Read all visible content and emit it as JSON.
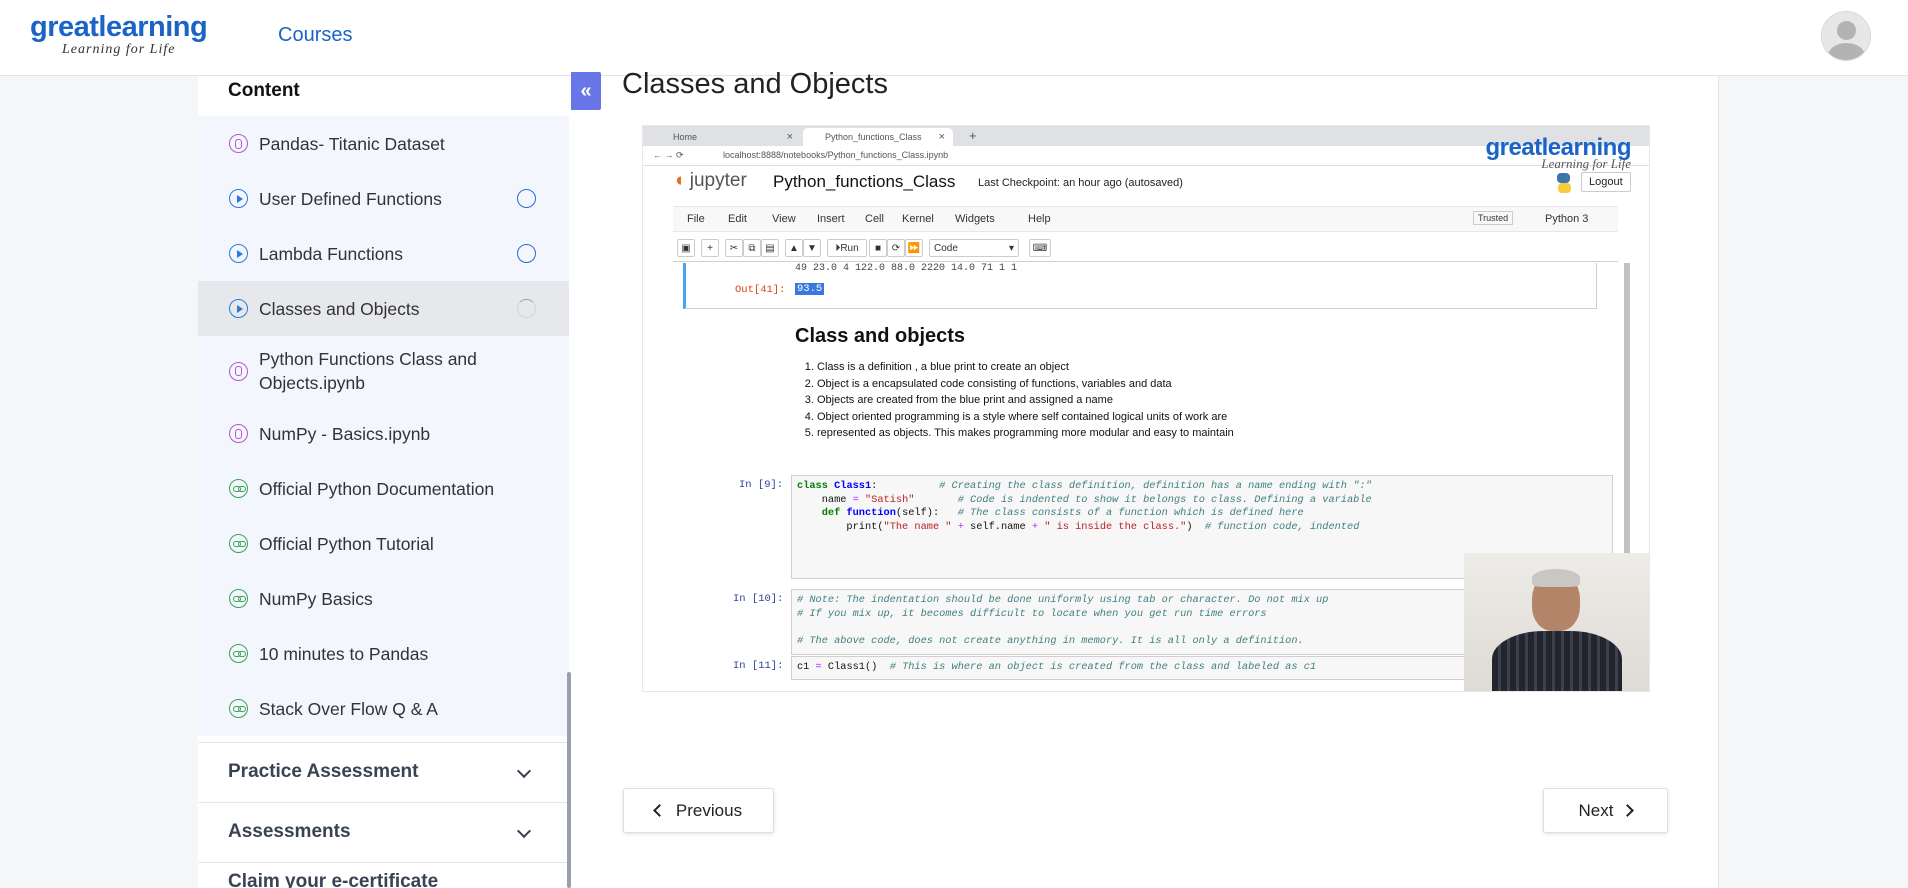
{
  "header": {
    "logo_main_a": "great",
    "logo_main_b": "learning",
    "logo_tagline": "Learning for Life",
    "courses_label": "Courses"
  },
  "sidebar": {
    "heading": "Content",
    "collapse_glyph": "«",
    "items": [
      {
        "label": "Pandas- Titanic Dataset",
        "icon": "attachment-icon",
        "status": ""
      },
      {
        "label": "User Defined Functions",
        "icon": "play-icon",
        "status": "not-started"
      },
      {
        "label": "Lambda Functions",
        "icon": "play-icon",
        "status": "not-started"
      },
      {
        "label": "Classes and Objects",
        "icon": "play-icon",
        "status": "in-progress"
      },
      {
        "label": "Python Functions Class and Objects.ipynb",
        "icon": "attachment-icon",
        "status": ""
      },
      {
        "label": "NumPy - Basics.ipynb",
        "icon": "attachment-icon",
        "status": ""
      },
      {
        "label": "Official Python Documentation",
        "icon": "link-icon",
        "status": ""
      },
      {
        "label": "Official Python Tutorial",
        "icon": "link-icon",
        "status": ""
      },
      {
        "label": "NumPy Basics",
        "icon": "link-icon",
        "status": ""
      },
      {
        "label": "10 minutes to Pandas",
        "icon": "link-icon",
        "status": ""
      },
      {
        "label": "Stack Over Flow Q & A",
        "icon": "link-icon",
        "status": ""
      }
    ],
    "sections": [
      {
        "label": "Practice Assessment"
      },
      {
        "label": "Assessments"
      },
      {
        "label": "Claim your e-certificate"
      }
    ]
  },
  "main": {
    "title": "Classes and Objects",
    "prev_label": "Previous",
    "next_label": "Next"
  },
  "video": {
    "browser_tab_1": "Home",
    "browser_tab_2": "Python_functions_Class",
    "url": "localhost:8888/notebooks/Python_functions_Class.ipynb",
    "watermark_main": "greatlearning",
    "watermark_tag": "Learning for Life",
    "jupyter_logo": "jupyter",
    "notebook_name": "Python_functions_Class",
    "checkpoint": "Last Checkpoint: an hour ago  (autosaved)",
    "logout": "Logout",
    "menu": [
      "File",
      "Edit",
      "View",
      "Insert",
      "Cell",
      "Kernel",
      "Widgets",
      "Help"
    ],
    "trusted": "Trusted",
    "kernel": "Python 3",
    "run_label": "Run",
    "cell_type": "Code",
    "top_numbers": "49  23.0    4  122.0   88.0  2220  14.0  71       1        1",
    "out_prompt": "Out[41]:",
    "out_value": "93.5",
    "md_heading": "Class and objects",
    "md_points": [
      "Class is a definition , a blue print to create an object",
      "Object is a encapsulated code consisting of functions, variables and data",
      "Objects are created from the blue print and assigned a name",
      "Object oriented programming is a style where self contained logical units of work are",
      "represented as objects. This makes programming more modular and easy to maintain"
    ],
    "in9": "In [9]:",
    "in10": "In [10]:",
    "in11": "In [11]:"
  }
}
